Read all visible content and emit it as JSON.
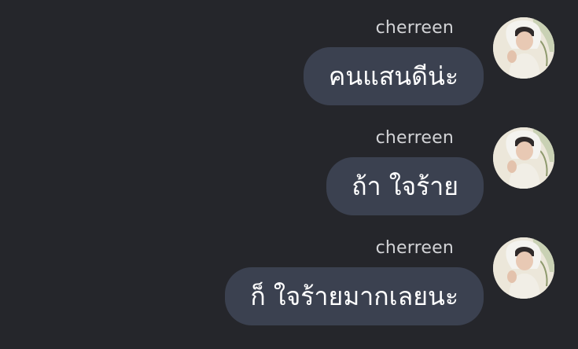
{
  "messages": [
    {
      "sender": "cherreen",
      "text": "คนแสนดีน่ะ",
      "avatar_icon": "user-avatar-photo"
    },
    {
      "sender": "cherreen",
      "text": "ถ้า ใจร้าย",
      "avatar_icon": "user-avatar-photo"
    },
    {
      "sender": "cherreen",
      "text": "ก็ ใจร้ายมากเลยนะ",
      "avatar_icon": "user-avatar-photo"
    }
  ],
  "colors": {
    "background": "#25262b",
    "bubble": "#3b4150",
    "sender_text": "#d2d3d6",
    "message_text": "#ffffff"
  }
}
